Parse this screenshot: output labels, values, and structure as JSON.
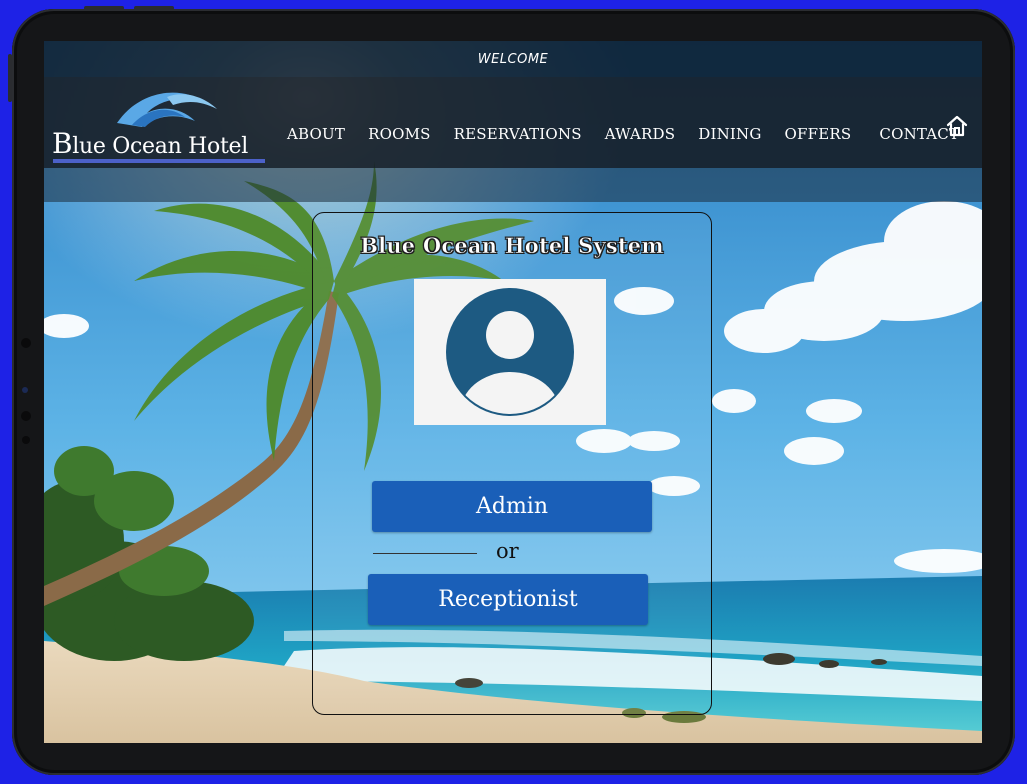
{
  "header": {
    "welcome": "WELCOME",
    "logo_text_first": "B",
    "logo_text_rest": "lue Ocean Hotel",
    "nav": [
      "ABOUT",
      "ROOMS",
      "RESERVATIONS",
      "AWARDS",
      "DINING",
      "OFFERS",
      "CONTACT"
    ],
    "home_icon": "home-icon"
  },
  "login": {
    "title": "Blue Ocean Hotel System",
    "avatar_icon": "user-avatar-icon",
    "admin_label": "Admin",
    "or_label": "or",
    "receptionist_label": "Receptionist"
  },
  "colors": {
    "page_background": "#1e22e6",
    "button": "#1a5fb8",
    "avatar": "#1d5a82",
    "logo_underline": "#4c61c9"
  }
}
